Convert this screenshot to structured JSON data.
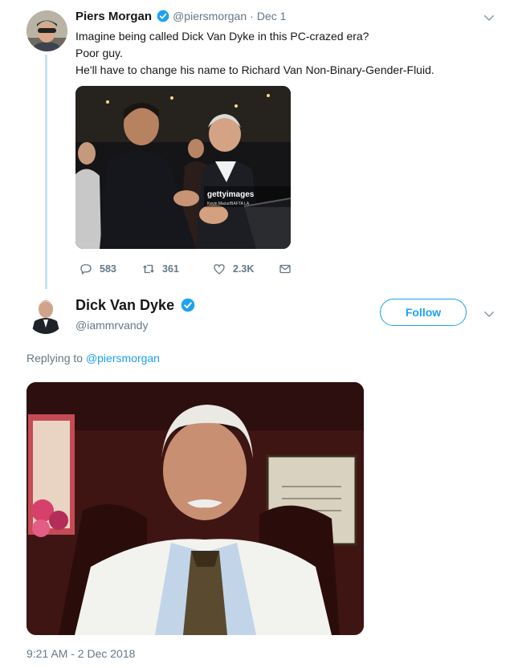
{
  "colors": {
    "accent": "#1da1f2",
    "muted": "#657786",
    "thread_line": "#c4e3f5"
  },
  "tweet": {
    "author_name": "Piers Morgan",
    "handle": "@piersmorgan",
    "separator": "·",
    "date": "Dec 1",
    "lines": [
      "Imagine being called Dick Van Dyke in this PC-crazed era?",
      "Poor guy.",
      "He'll have to change his name to Richard Van Non-Binary-Gender-Fluid."
    ],
    "photo": {
      "watermark": "gettyimages",
      "watermark_credit": "Kevin Mazur/BAFTA LA",
      "photo_id": "80799474"
    },
    "stats": {
      "replies": "583",
      "retweets": "361",
      "likes": "2.3K"
    },
    "icons": [
      "reply-icon",
      "retweet-icon",
      "like-icon",
      "message-icon",
      "verified-icon",
      "chevron-down-icon"
    ]
  },
  "reply": {
    "author_name": "Dick Van Dyke",
    "handle": "@iammrvandy",
    "follow_label": "Follow",
    "replying_prefix": "Replying to",
    "replying_to": "@piersmorgan",
    "timestamp": "9:21 AM - 2 Dec 2018"
  }
}
